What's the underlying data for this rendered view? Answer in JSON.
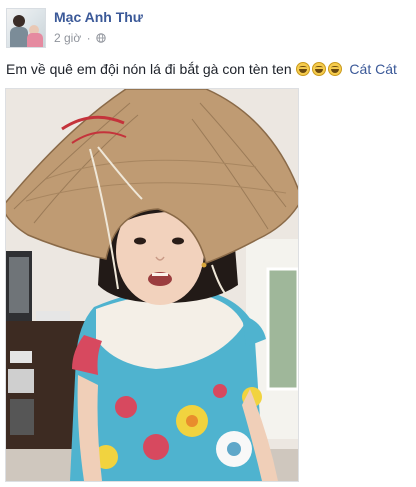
{
  "post": {
    "author_name": "Mạc Anh Thư",
    "timestamp": "2 giờ",
    "separator": "·",
    "privacy_icon": "globe-icon",
    "caption_text": "Em về quê em đội nón lá đi bắt gà con tèn ten ",
    "emoji_icon": "grinning-face-icon",
    "emoji_count": 3,
    "tagged_person": "Cát Cát"
  },
  "colors": {
    "link_blue": "#3b5998",
    "meta_gray": "#90949c",
    "text_dark": "#1d2129"
  }
}
